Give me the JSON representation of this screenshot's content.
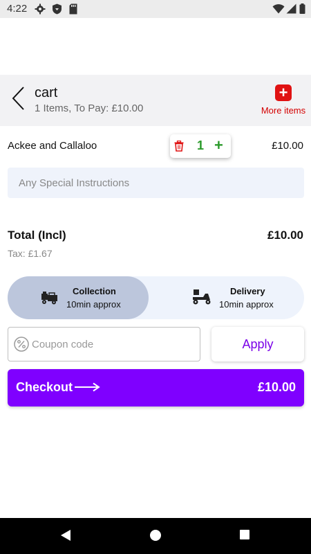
{
  "status_bar": {
    "time": "4:22",
    "left_icons": [
      "settings-icon",
      "shield-icon",
      "sd-card-icon"
    ],
    "right_icons": [
      "wifi-icon",
      "signal-icon",
      "battery-icon"
    ]
  },
  "header": {
    "title": "cart",
    "subtitle": "1 Items, To Pay: £10.00",
    "more_items_label": "More items",
    "more_items_icon": "+"
  },
  "cart": {
    "items": [
      {
        "name": "Ackee and Callaloo",
        "quantity": "1",
        "price": "£10.00"
      }
    ],
    "special_instructions_placeholder": "Any Special Instructions"
  },
  "totals": {
    "total_label": "Total (Incl)",
    "total_value": "£10.00",
    "tax": "Tax: £1.67"
  },
  "order_mode": {
    "options": [
      {
        "name": "Collection",
        "time": "10min approx",
        "selected": true
      },
      {
        "name": "Delivery",
        "time": "10min approx",
        "selected": false
      }
    ]
  },
  "coupon": {
    "placeholder": "Coupon code",
    "value": "",
    "apply_label": "Apply"
  },
  "checkout": {
    "label": "Checkout",
    "total": "£10.00"
  },
  "colors": {
    "accent": "#7f00ff",
    "brand_red": "#e01212",
    "quantity_green": "#2b9a2b",
    "header_bg": "#f2f2f4",
    "selected_mode_bg": "#bcc6dc"
  }
}
